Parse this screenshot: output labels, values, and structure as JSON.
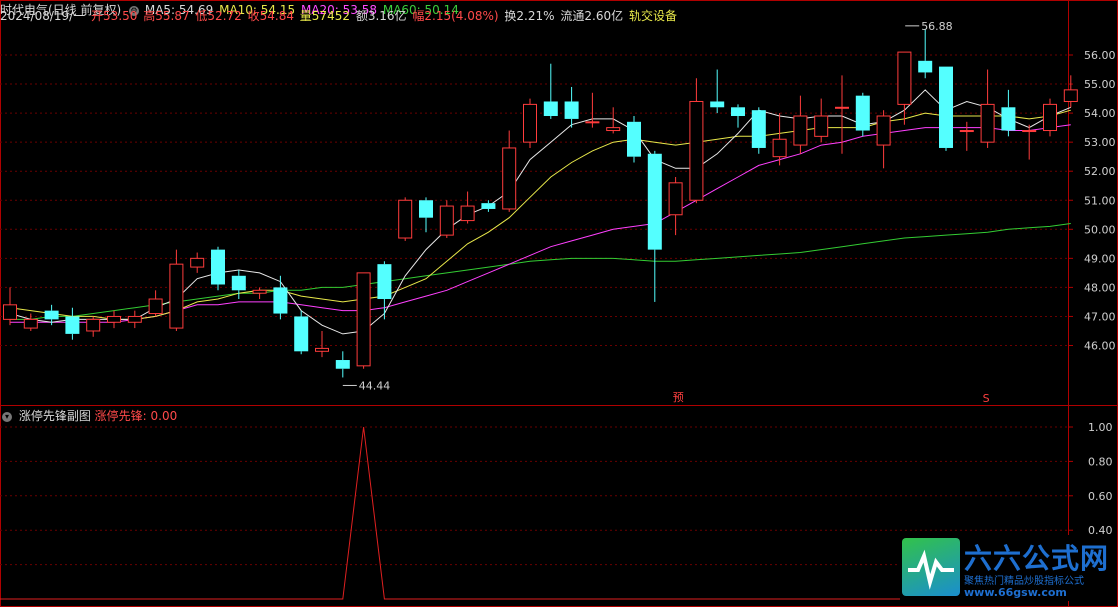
{
  "header": {
    "title": "时代电气(日线 前复权)",
    "ma5": "MA5: 54.69",
    "ma10": "MA10: 54.15",
    "ma20": "MA20: 53.58",
    "ma60": "MA60: 50.14",
    "date": "2024/08/19/一",
    "open": "开53.50",
    "high": "高55.87",
    "low": "低52.72",
    "close": "收54.84",
    "volume": "量57452",
    "amount": "额3.16亿",
    "change": "幅2.15(4.08%)",
    "turnover": "换2.21%",
    "float_shares": "流通2.60亿",
    "sector": "轨交设备"
  },
  "sub_header": {
    "indicator_name": "涨停先锋副图",
    "indicator_value": "涨停先锋: 0.00"
  },
  "markers": {
    "yu": "预",
    "s": "S"
  },
  "logo": {
    "title": "六六公式网",
    "subtitle": "聚焦热门精品炒股指标公式",
    "url": "www.66gsw.com"
  },
  "colors": {
    "up": "#ff3c3c",
    "down": "#54ffff",
    "ma5": "#e8e8e8",
    "ma10": "#e8e84a",
    "ma20": "#ff40ff",
    "ma60": "#33cc33",
    "indicator": "#e02020"
  },
  "chart_data": [
    {
      "type": "candlestick",
      "title": "时代电气(日线 前复权)",
      "ylim": [
        45.3,
        56.6
      ],
      "y_ticks": [
        "56.00",
        "55.00",
        "54.00",
        "53.00",
        "52.00",
        "51.00",
        "50.00",
        "49.00",
        "48.00",
        "47.00",
        "46.00"
      ],
      "annotations": {
        "high": "56.88",
        "low": "44.44"
      },
      "candles": [
        [
          46.9,
          47.4,
          46.7,
          48.0
        ],
        [
          46.6,
          46.9,
          46.5,
          47.1
        ],
        [
          47.2,
          46.9,
          46.7,
          47.4
        ],
        [
          47.0,
          46.4,
          46.2,
          47.3
        ],
        [
          46.5,
          46.9,
          46.3,
          47.0
        ],
        [
          46.8,
          47.0,
          46.6,
          47.2
        ],
        [
          46.8,
          47.0,
          46.6,
          47.2
        ],
        [
          47.1,
          47.6,
          47.0,
          47.9
        ],
        [
          46.6,
          48.8,
          46.5,
          49.3
        ],
        [
          48.7,
          49.0,
          48.5,
          49.2
        ],
        [
          49.3,
          48.1,
          47.9,
          49.4
        ],
        [
          48.4,
          47.9,
          47.6,
          48.6
        ],
        [
          47.8,
          47.9,
          47.6,
          48.0
        ],
        [
          48.0,
          47.1,
          46.9,
          48.4
        ],
        [
          47.0,
          45.8,
          45.7,
          47.2
        ],
        [
          45.8,
          45.9,
          45.6,
          46.5
        ],
        [
          45.5,
          45.2,
          44.9,
          45.8
        ],
        [
          45.3,
          48.5,
          45.2,
          48.5
        ],
        [
          48.8,
          47.6,
          46.9,
          48.9
        ],
        [
          49.7,
          51.0,
          49.6,
          51.1
        ],
        [
          51.0,
          50.4,
          49.9,
          51.1
        ],
        [
          49.8,
          50.8,
          49.7,
          51.0
        ],
        [
          50.3,
          50.8,
          50.2,
          51.3
        ],
        [
          50.9,
          50.7,
          50.6,
          51.0
        ],
        [
          50.7,
          52.8,
          50.6,
          53.4
        ],
        [
          53.0,
          54.3,
          52.8,
          54.5
        ],
        [
          54.4,
          53.9,
          53.8,
          55.7
        ],
        [
          54.4,
          53.8,
          53.5,
          54.9
        ],
        [
          53.7,
          53.7,
          53.5,
          54.7
        ],
        [
          53.4,
          53.5,
          53.3,
          54.2
        ],
        [
          53.7,
          52.5,
          52.3,
          53.9
        ],
        [
          52.6,
          49.3,
          47.5,
          52.7
        ],
        [
          50.5,
          51.6,
          49.8,
          51.8
        ],
        [
          51.0,
          54.4,
          50.9,
          55.2
        ],
        [
          54.4,
          54.2,
          54.0,
          55.5
        ],
        [
          54.2,
          53.9,
          53.5,
          54.3
        ],
        [
          54.1,
          52.8,
          52.6,
          54.2
        ],
        [
          52.5,
          53.1,
          52.2,
          54.0
        ],
        [
          52.9,
          53.9,
          52.6,
          54.6
        ],
        [
          53.2,
          53.9,
          53.0,
          54.5
        ],
        [
          54.2,
          54.2,
          52.6,
          55.3
        ],
        [
          54.6,
          53.4,
          53.2,
          54.7
        ],
        [
          52.9,
          53.9,
          52.1,
          54.1
        ],
        [
          54.3,
          56.1,
          53.6,
          56.1
        ],
        [
          55.8,
          55.4,
          55.2,
          56.9
        ],
        [
          55.6,
          52.8,
          52.7,
          55.6
        ],
        [
          53.4,
          53.4,
          52.7,
          53.7
        ],
        [
          53.0,
          54.3,
          52.8,
          55.5
        ],
        [
          54.2,
          53.4,
          53.2,
          54.8
        ],
        [
          53.4,
          53.4,
          52.4,
          53.6
        ],
        [
          53.4,
          54.3,
          53.2,
          54.5
        ],
        [
          54.4,
          54.8,
          54.2,
          55.3
        ]
      ],
      "ma5": [
        47.1,
        46.9,
        46.8,
        46.9,
        46.9,
        46.9,
        46.9,
        47.3,
        47.6,
        48.3,
        48.5,
        48.6,
        48.5,
        48.2,
        47.2,
        46.7,
        46.4,
        46.5,
        47.1,
        48.4,
        49.3,
        50.0,
        50.5,
        50.8,
        51.3,
        52.4,
        53.0,
        53.6,
        53.8,
        53.8,
        53.4,
        52.4,
        52.1,
        52.1,
        52.6,
        53.3,
        54.1,
        53.9,
        53.8,
        53.9,
        53.9,
        53.6,
        53.7,
        54.1,
        54.8,
        54.1,
        54.4,
        54.2,
        53.8,
        53.5,
        53.9,
        54.2
      ],
      "ma10": [
        47.3,
        47.2,
        47.1,
        47.0,
        47.0,
        46.9,
        46.9,
        47.0,
        47.2,
        47.5,
        47.6,
        47.8,
        47.9,
        47.9,
        47.7,
        47.6,
        47.5,
        47.6,
        47.7,
        48.0,
        48.3,
        48.9,
        49.5,
        49.9,
        50.4,
        51.1,
        51.8,
        52.3,
        52.7,
        53.0,
        53.1,
        53.0,
        52.9,
        53.0,
        53.1,
        53.2,
        53.2,
        53.3,
        53.4,
        53.5,
        53.5,
        53.5,
        53.7,
        53.8,
        54.0,
        53.9,
        53.9,
        53.9,
        53.9,
        53.8,
        53.9,
        54.1
      ],
      "ma20": [
        46.8,
        46.8,
        46.8,
        46.8,
        46.8,
        46.8,
        46.9,
        47.0,
        47.2,
        47.4,
        47.4,
        47.5,
        47.5,
        47.5,
        47.4,
        47.3,
        47.2,
        47.2,
        47.3,
        47.5,
        47.7,
        47.9,
        48.2,
        48.5,
        48.8,
        49.1,
        49.4,
        49.6,
        49.8,
        50.0,
        50.1,
        50.2,
        50.6,
        51.0,
        51.4,
        51.8,
        52.2,
        52.4,
        52.6,
        52.9,
        53.0,
        53.2,
        53.3,
        53.4,
        53.5,
        53.5,
        53.5,
        53.5,
        53.4,
        53.4,
        53.5,
        53.6
      ],
      "ma60": [
        46.9,
        46.9,
        47.0,
        47.0,
        47.1,
        47.2,
        47.3,
        47.4,
        47.5,
        47.6,
        47.7,
        47.8,
        47.8,
        47.9,
        47.9,
        48.0,
        48.0,
        48.1,
        48.2,
        48.3,
        48.4,
        48.5,
        48.6,
        48.7,
        48.8,
        48.9,
        48.95,
        49.0,
        49.0,
        49.0,
        48.95,
        48.9,
        48.9,
        48.95,
        49.0,
        49.05,
        49.1,
        49.15,
        49.2,
        49.3,
        49.4,
        49.5,
        49.6,
        49.7,
        49.75,
        49.8,
        49.85,
        49.9,
        50.0,
        50.05,
        50.1,
        50.2
      ]
    },
    {
      "type": "line",
      "title": "涨停先锋副图",
      "series": [
        {
          "name": "涨停先锋",
          "values": [
            0,
            0,
            0,
            0,
            0,
            0,
            0,
            0,
            0,
            0,
            0,
            0,
            0,
            0,
            0,
            0,
            0,
            1,
            0,
            0,
            0,
            0,
            0,
            0,
            0,
            0,
            0,
            0,
            0,
            0,
            0,
            0,
            0,
            0,
            0,
            0,
            0,
            0,
            0,
            0,
            0,
            0,
            0,
            0,
            0,
            0,
            0,
            0,
            0,
            0,
            0,
            0
          ]
        }
      ],
      "ylim": [
        0,
        1.05
      ],
      "y_ticks": [
        "1.00",
        "0.80",
        "0.60",
        "0.40",
        "0.20"
      ]
    }
  ]
}
